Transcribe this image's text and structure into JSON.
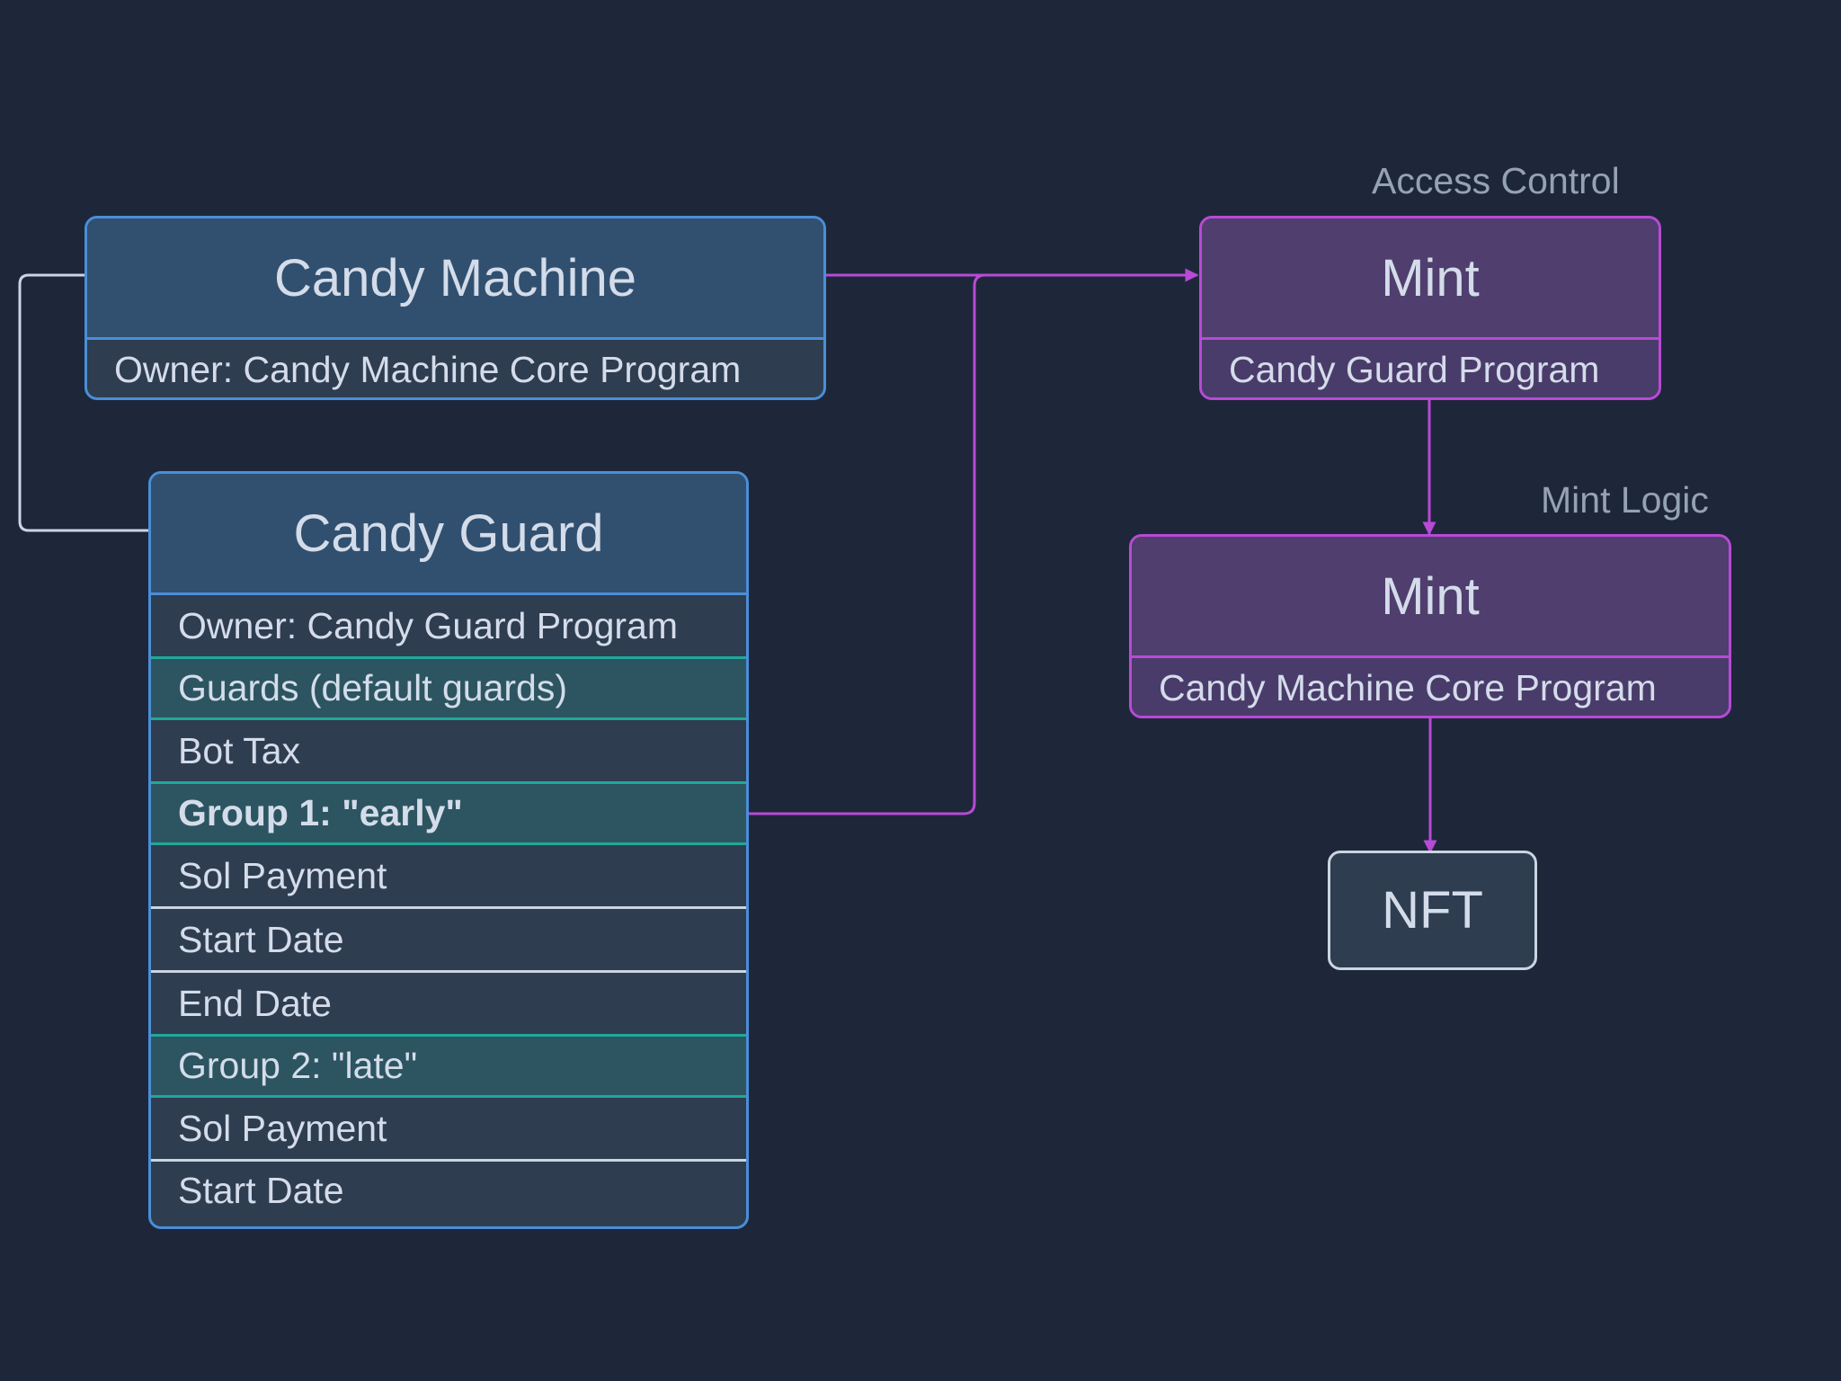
{
  "candy_machine": {
    "title": "Candy Machine",
    "owner": "Owner: Candy Machine Core Program"
  },
  "candy_guard": {
    "title": "Candy Guard",
    "rows": [
      "Owner: Candy Guard Program",
      "Guards (default guards)",
      "Bot Tax",
      "Group 1: \"early\"",
      "Sol Payment",
      "Start Date",
      "End Date",
      "Group 2: \"late\"",
      "Sol Payment",
      "Start Date"
    ]
  },
  "access_control": {
    "caption": "Access Control",
    "title": "Mint",
    "program": "Candy Guard Program"
  },
  "mint_logic": {
    "caption": "Mint Logic",
    "title": "Mint",
    "program": "Candy Machine Core Program"
  },
  "nft": {
    "label": "NFT"
  },
  "colors": {
    "background": "#1e273a",
    "account_border": "#4a8ed8",
    "group_highlight": "#1fa99a",
    "instruction_border": "#b84ad6",
    "connector_gray": "#cbd5e1"
  }
}
